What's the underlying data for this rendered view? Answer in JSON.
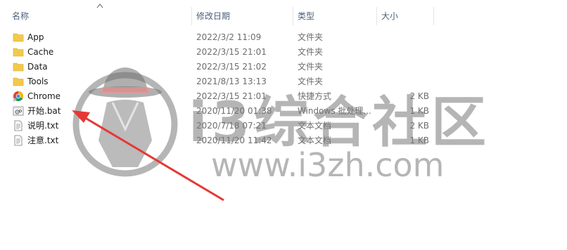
{
  "columns": {
    "name": "名称",
    "date": "修改日期",
    "type": "类型",
    "size": "大小"
  },
  "rows": [
    {
      "name": "App",
      "date": "2022/3/2 11:09",
      "type": "文件夹",
      "size": "",
      "icon": "folder-icon"
    },
    {
      "name": "Cache",
      "date": "2022/3/15 21:01",
      "type": "文件夹",
      "size": "",
      "icon": "folder-icon"
    },
    {
      "name": "Data",
      "date": "2022/3/15 21:02",
      "type": "文件夹",
      "size": "",
      "icon": "folder-icon"
    },
    {
      "name": "Tools",
      "date": "2021/8/13 13:13",
      "type": "文件夹",
      "size": "",
      "icon": "folder-icon"
    },
    {
      "name": "Chrome",
      "date": "2022/3/15 21:01",
      "type": "快捷方式",
      "size": "2 KB",
      "icon": "chrome-icon"
    },
    {
      "name": "开始.bat",
      "date": "2020/11/20 01:38",
      "type": "Windows 批处理...",
      "size": "1 KB",
      "icon": "batch-file-icon"
    },
    {
      "name": "说明.txt",
      "date": "2020/7/18 07:21",
      "type": "文本文档",
      "size": "2 KB",
      "icon": "text-file-icon"
    },
    {
      "name": "注意.txt",
      "date": "2020/11/20 11:42",
      "type": "文本文档",
      "size": "1 KB",
      "icon": "text-file-icon"
    }
  ],
  "watermark": {
    "brand_cn": "i3综合社区",
    "url": "www.i3zh.com"
  },
  "colors": {
    "folder": "#f2c94c",
    "arrow": "#e53935",
    "watermark": "#7a7a7a"
  }
}
